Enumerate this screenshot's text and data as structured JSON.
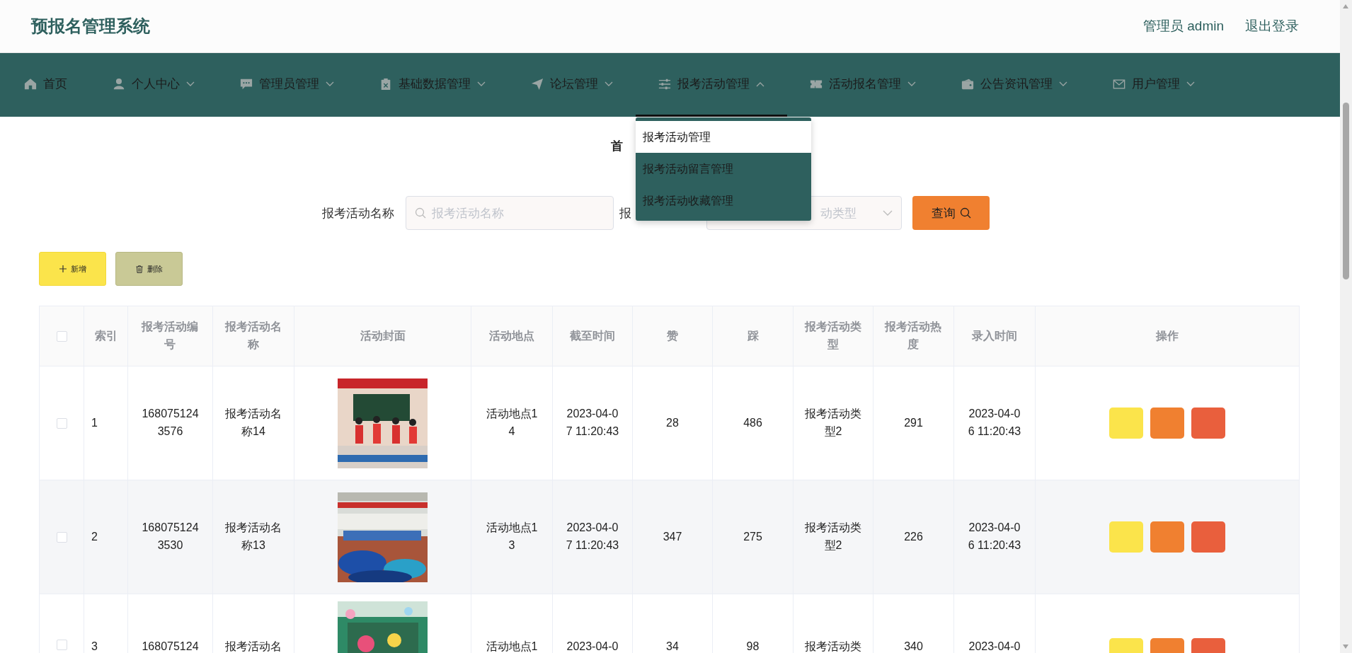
{
  "header": {
    "title": "预报名管理系统",
    "user": "管理员 admin",
    "logout": "退出登录"
  },
  "nav": [
    {
      "label": "首页",
      "has_menu": false,
      "selected": false
    },
    {
      "label": "个人中心",
      "has_menu": true,
      "selected": false,
      "expanded": false
    },
    {
      "label": "管理员管理",
      "has_menu": true,
      "selected": false,
      "expanded": false
    },
    {
      "label": "基础数据管理",
      "has_menu": true,
      "selected": false,
      "expanded": false
    },
    {
      "label": "论坛管理",
      "has_menu": true,
      "selected": false,
      "expanded": false
    },
    {
      "label": "报考活动管理",
      "has_menu": true,
      "selected": true,
      "expanded": true,
      "menu": [
        {
          "label": "报考活动管理",
          "selected": true
        },
        {
          "label": "报考活动留言管理",
          "selected": false
        },
        {
          "label": "报考活动收藏管理",
          "selected": false
        }
      ]
    },
    {
      "label": "活动报名管理",
      "has_menu": true,
      "selected": false,
      "expanded": false
    },
    {
      "label": "公告资讯管理",
      "has_menu": true,
      "selected": false,
      "expanded": false
    },
    {
      "label": "用户管理",
      "has_menu": true,
      "selected": false,
      "expanded": false
    }
  ],
  "breadcrumb": "首",
  "search": {
    "fields": [
      {
        "kind": "text",
        "label": "报考活动名称",
        "placeholder": "报考活动名称"
      },
      {
        "kind": "select",
        "label": "报",
        "placeholder": "动类型"
      }
    ],
    "button": "查询"
  },
  "actions": [
    {
      "kind": "add",
      "label": "新增"
    },
    {
      "kind": "delete",
      "label": "删除"
    }
  ],
  "table": {
    "all_checked": false,
    "columns": [
      "索引",
      "报考活动编号",
      "报考活动名称",
      "活动封面",
      "活动地点",
      "截至时间",
      "赞",
      "踩",
      "报考活动类型",
      "报考活动热度",
      "录入时间",
      "操作"
    ],
    "row_buttons": [
      {
        "color": "#fbe44b"
      },
      {
        "color": "#f08030"
      },
      {
        "color": "#e95f3d"
      }
    ],
    "rows": [
      {
        "checked": false,
        "cells": [
          "1",
          "1680751243576",
          "报考活动名称14",
          {
            "kind": "picture"
          },
          "活动地点14",
          "2023-04-07 11:20:43",
          "28",
          "486",
          "报考活动类型2",
          "291",
          "2023-04-06 11:20:43"
        ]
      },
      {
        "checked": false,
        "cells": [
          "2",
          "1680751243530",
          "报考活动名称13",
          {
            "kind": "picture"
          },
          "活动地点13",
          "2023-04-07 11:20:43",
          "347",
          "275",
          "报考活动类型2",
          "226",
          "2023-04-06 11:20:43"
        ]
      },
      {
        "checked": false,
        "cells": [
          "3",
          "168075124",
          "报考活动名",
          {
            "kind": "picture"
          },
          "活动地点1",
          "2023-04-0",
          "34",
          "98",
          "报考活动类",
          "340",
          "2023-04-0"
        ]
      }
    ]
  }
}
